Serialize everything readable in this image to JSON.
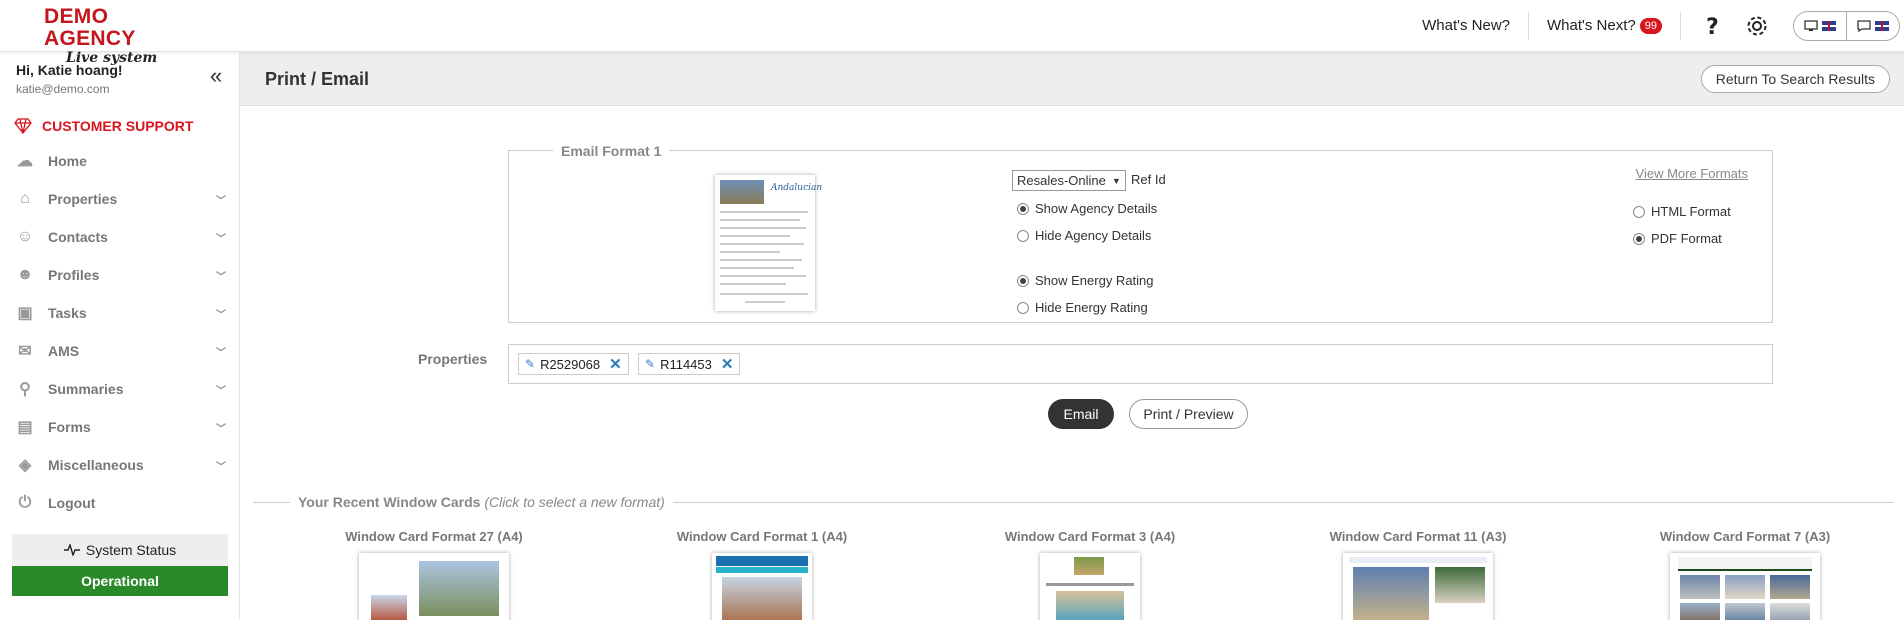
{
  "brand": {
    "name_line1": "DEMO AGENCY",
    "name_line2": "Live system",
    "accent": "#c4161c"
  },
  "topnav": {
    "whats_new": "What's New?",
    "whats_next": "What's Next?",
    "whats_next_count": "99",
    "help_icon": "question-icon",
    "settings_icon": "gear-icon",
    "lang_pills": [
      {
        "icon": "monitor-icon"
      },
      {
        "icon": "chat-icon"
      }
    ]
  },
  "user": {
    "greeting": "Hi, Katie hoang!",
    "email": "katie@demo.com"
  },
  "sidebar": {
    "support_label": "CUSTOMER SUPPORT",
    "items": [
      {
        "label": "Home",
        "icon": "cloud-icon",
        "expandable": false
      },
      {
        "label": "Properties",
        "icon": "house-icon",
        "expandable": true
      },
      {
        "label": "Contacts",
        "icon": "user-icon",
        "expandable": true
      },
      {
        "label": "Profiles",
        "icon": "users-icon",
        "expandable": true
      },
      {
        "label": "Tasks",
        "icon": "briefcase-icon",
        "expandable": true
      },
      {
        "label": "AMS",
        "icon": "envelope-icon",
        "expandable": true
      },
      {
        "label": "Summaries",
        "icon": "sitemap-icon",
        "expandable": true
      },
      {
        "label": "Forms",
        "icon": "clipboard-icon",
        "expandable": true
      },
      {
        "label": "Miscellaneous",
        "icon": "box-icon",
        "expandable": true
      },
      {
        "label": "Logout",
        "icon": "power-icon",
        "expandable": false
      }
    ],
    "system_status_label": "System Status",
    "system_status_value": "Operational",
    "status_color": "#2a8a2a"
  },
  "page": {
    "title": "Print / Email",
    "return_button": "Return To Search Results"
  },
  "email_format": {
    "legend": "Email Format 1",
    "thumb_logo": "Andalucian",
    "ref_select_value": "Resales-Online",
    "ref_label": "Ref Id",
    "agency_options": [
      {
        "label": "Show Agency Details",
        "checked": true
      },
      {
        "label": "Hide Agency Details",
        "checked": false
      }
    ],
    "energy_options": [
      {
        "label": "Show Energy Rating",
        "checked": true
      },
      {
        "label": "Hide Energy Rating",
        "checked": false
      }
    ],
    "view_more": "View More Formats",
    "format_options": [
      {
        "label": "HTML Format",
        "checked": false
      },
      {
        "label": "PDF Format",
        "checked": true
      }
    ]
  },
  "properties": {
    "label": "Properties",
    "tags": [
      "R2529068",
      "R114453"
    ]
  },
  "actions": {
    "email": "Email",
    "print_preview": "Print / Preview"
  },
  "recent": {
    "title": "Your Recent Window Cards",
    "hint": "(Click to select a new format)",
    "cards": [
      "Window Card Format 27 (A4)",
      "Window Card Format 1 (A4)",
      "Window Card Format 3 (A4)",
      "Window Card Format 11 (A3)",
      "Window Card Format 7 (A3)"
    ]
  }
}
